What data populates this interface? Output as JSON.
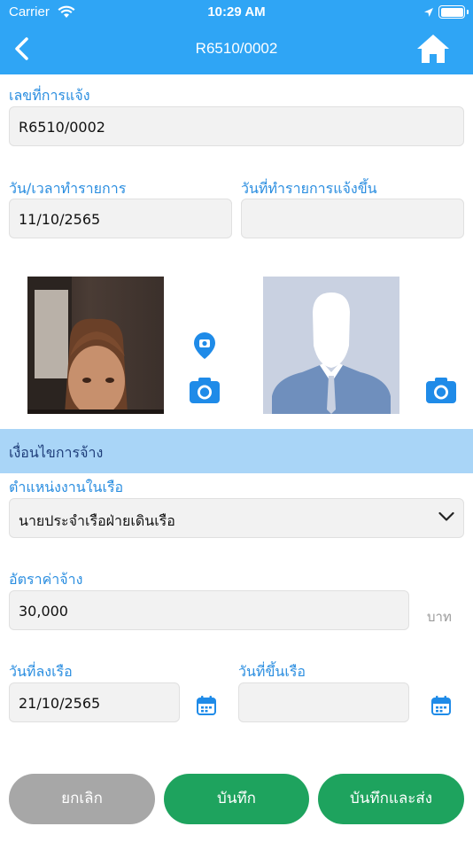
{
  "status_bar": {
    "carrier": "Carrier",
    "time": "10:29 AM"
  },
  "nav": {
    "title": "R6510/0002"
  },
  "form": {
    "report_no_label": "เลขที่การแจ้ง",
    "report_no_value": "R6510/0002",
    "tx_datetime_label": "วัน/เวลาทำรายการ",
    "tx_datetime_value": "11/10/2565",
    "report_created_label": "วันที่ทำรายการแจ้งขึ้น",
    "report_created_value": ""
  },
  "section": {
    "title": "เงื่อนไขการจ้าง"
  },
  "employment": {
    "position_label": "ตำแหน่งงานในเรือ",
    "position_value": "นายประจำเรือฝ่ายเดินเรือ",
    "wage_label": "อัตราค่าจ้าง",
    "wage_value": "30,000",
    "wage_unit": "บาท",
    "board_date_label": "วันที่ลงเรือ",
    "board_date_value": "21/10/2565",
    "disembark_date_label": "วันที่ขึ้นเรือ",
    "disembark_date_value": ""
  },
  "buttons": {
    "cancel": "ยกเลิก",
    "save": "บันทึก",
    "save_send": "บันทึกและส่ง"
  },
  "colors": {
    "accent": "#2fa5f5",
    "label": "#2b8ee0",
    "section_bg": "#a9d5f7",
    "primary_button": "#1ea35e",
    "cancel_button": "#a7a7a7"
  }
}
